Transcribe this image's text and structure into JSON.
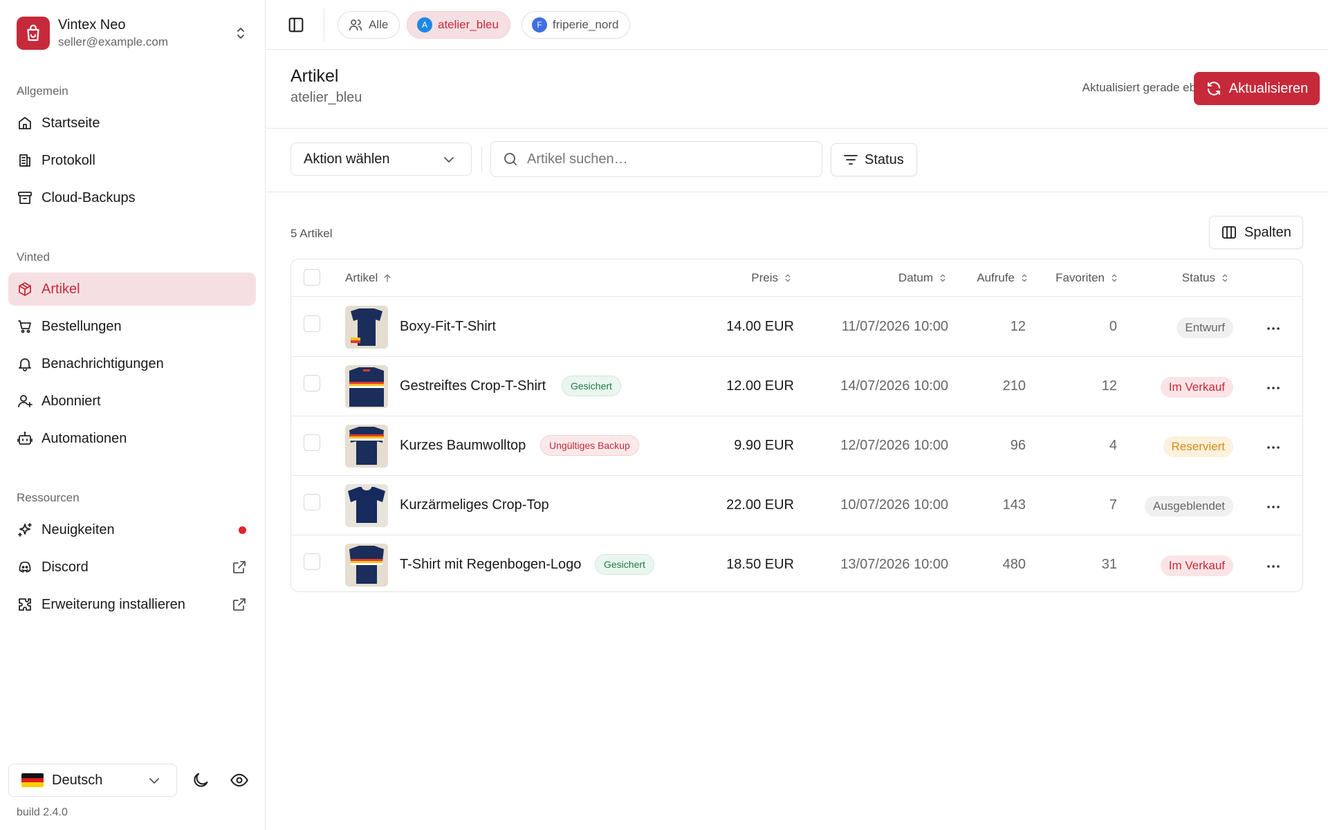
{
  "sidebar": {
    "brand": {
      "name": "Vintex Neo",
      "email": "seller@example.com"
    },
    "sections": {
      "general": "Allgemein",
      "vinted": "Vinted",
      "resources": "Ressourcen"
    },
    "items": [
      {
        "label": "Startseite",
        "icon": "home-icon"
      },
      {
        "label": "Protokoll",
        "icon": "log-icon"
      },
      {
        "label": "Cloud-Backups",
        "icon": "archive-icon"
      },
      {
        "label": "Artikel",
        "icon": "package-icon",
        "active": true
      },
      {
        "label": "Bestellungen",
        "icon": "cart-icon"
      },
      {
        "label": "Benachrichtigungen",
        "icon": "bell-icon"
      },
      {
        "label": "Abonniert",
        "icon": "user-plus-icon"
      },
      {
        "label": "Automationen",
        "icon": "bot-icon"
      },
      {
        "label": "Neuigkeiten",
        "icon": "sparkles-icon",
        "unread": true
      },
      {
        "label": "Discord",
        "icon": "discord-icon",
        "external": true
      },
      {
        "label": "Erweiterung installieren",
        "icon": "puzzle-icon",
        "external": true
      }
    ],
    "language": "Deutsch",
    "build": "build 2.4.0"
  },
  "topbar": {
    "chips": [
      {
        "label": "Alle"
      },
      {
        "label": "atelier_bleu",
        "initial": "A",
        "color": "#1e88e5",
        "active": true
      },
      {
        "label": "friperie_nord",
        "initial": "F",
        "color": "#3f6fe0"
      }
    ]
  },
  "page": {
    "title": "Artikel",
    "subtitle": "atelier_bleu",
    "updated": "Aktualisiert gerade eben",
    "refresh_label": "Aktualisieren"
  },
  "toolbar": {
    "action_select": "Aktion wählen",
    "search_placeholder": "Artikel suchen…",
    "status_filter": "Status"
  },
  "table": {
    "count": "5 Artikel",
    "columns_button": "Spalten",
    "headers": {
      "article": "Artikel",
      "price": "Preis",
      "date": "Datum",
      "views": "Aufrufe",
      "favorites": "Favoriten",
      "status": "Status"
    },
    "rows": [
      {
        "name": "Boxy-Fit-T-Shirt",
        "badge": "",
        "price": "14.00 EUR",
        "date": "11/07/2026 10:00",
        "views": "12",
        "favorites": "0",
        "status": "Entwurf"
      },
      {
        "name": "Gestreiftes Crop-T-Shirt",
        "badge": "Gesichert",
        "price": "12.00 EUR",
        "date": "14/07/2026 10:00",
        "views": "210",
        "favorites": "12",
        "status": "Im Verkauf"
      },
      {
        "name": "Kurzes Baumwolltop",
        "badge": "Ungültiges Backup",
        "price": "9.90 EUR",
        "date": "12/07/2026 10:00",
        "views": "96",
        "favorites": "4",
        "status": "Reserviert"
      },
      {
        "name": "Kurzärmeliges Crop-Top",
        "badge": "",
        "price": "22.00 EUR",
        "date": "10/07/2026 10:00",
        "views": "143",
        "favorites": "7",
        "status": "Ausgeblendet"
      },
      {
        "name": "T-Shirt mit Regenbogen-Logo",
        "badge": "Gesichert",
        "price": "18.50 EUR",
        "date": "13/07/2026 10:00",
        "views": "480",
        "favorites": "31",
        "status": "Im Verkauf"
      }
    ]
  },
  "colors": {
    "accent": "#c62a3a",
    "accent_soft": "#f6dfe2"
  }
}
